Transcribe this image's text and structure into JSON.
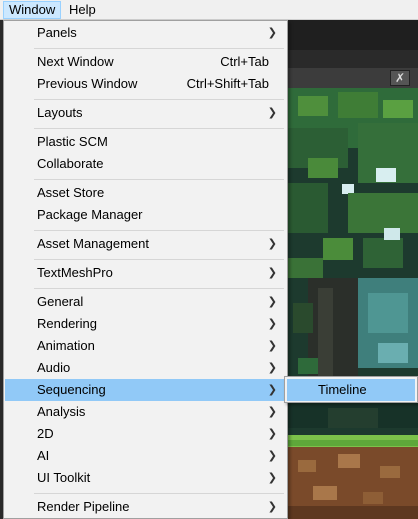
{
  "menubar": {
    "window": "Window",
    "help": "Help"
  },
  "editor": {
    "tool_icon": "wrench-cross-icon"
  },
  "menu": {
    "panels": "Panels",
    "next_window": "Next Window",
    "next_window_shortcut": "Ctrl+Tab",
    "previous_window": "Previous Window",
    "previous_window_shortcut": "Ctrl+Shift+Tab",
    "layouts": "Layouts",
    "plastic_scm": "Plastic SCM",
    "collaborate": "Collaborate",
    "asset_store": "Asset Store",
    "package_manager": "Package Manager",
    "asset_management": "Asset Management",
    "textmeshpro": "TextMeshPro",
    "general": "General",
    "rendering": "Rendering",
    "animation": "Animation",
    "audio": "Audio",
    "sequencing": "Sequencing",
    "analysis": "Analysis",
    "twod": "2D",
    "ai": "AI",
    "ui_toolkit": "UI Toolkit",
    "render_pipeline": "Render Pipeline"
  },
  "submenu": {
    "timeline": "Timeline"
  },
  "colors": {
    "highlight": "#91c9f7",
    "menu_bg": "#f2f2f2",
    "menubar_open": "#cce8ff"
  }
}
